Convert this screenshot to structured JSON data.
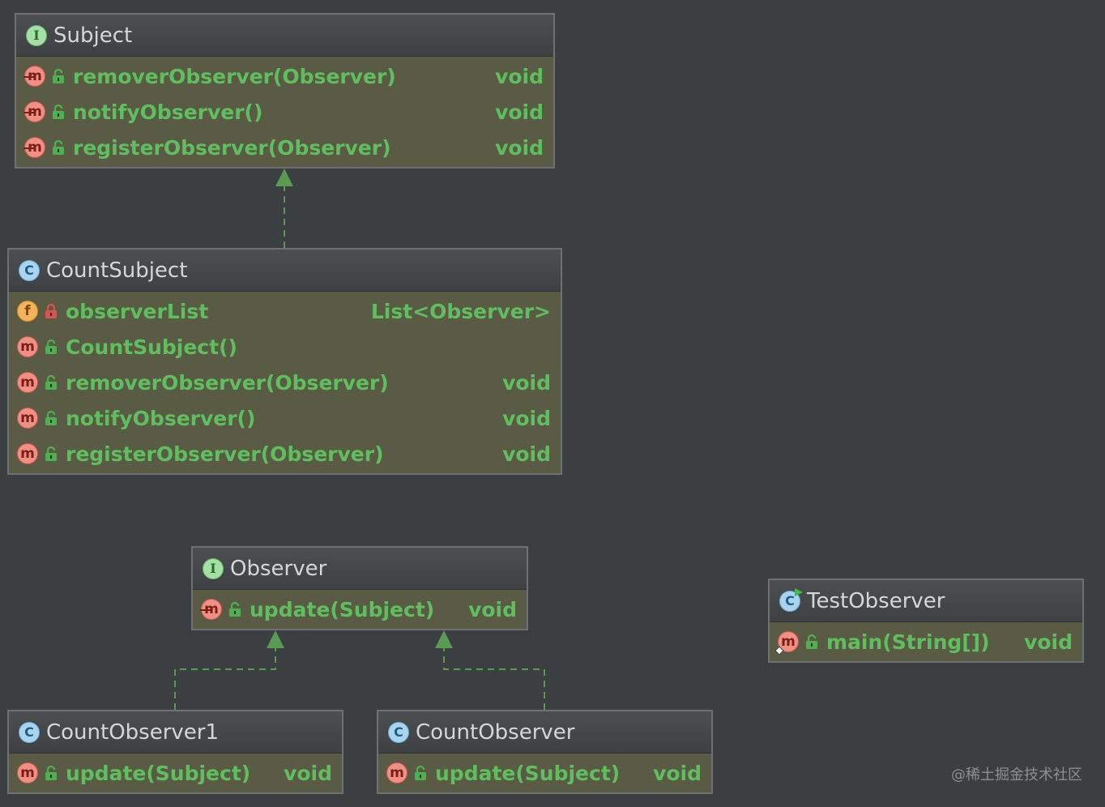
{
  "diagram": {
    "nodes": [
      {
        "id": "subject",
        "kind": "interface",
        "kind_letter": "I",
        "title": "Subject",
        "members": [
          {
            "icon": "method-abstract-icon",
            "letter": "m",
            "visibility": "public",
            "name": "removerObserver(Observer)",
            "type": "void"
          },
          {
            "icon": "method-abstract-icon",
            "letter": "m",
            "visibility": "public",
            "name": "notifyObserver()",
            "type": "void"
          },
          {
            "icon": "method-abstract-icon",
            "letter": "m",
            "visibility": "public",
            "name": "registerObserver(Observer)",
            "type": "void"
          }
        ]
      },
      {
        "id": "count-subject",
        "kind": "class",
        "kind_letter": "C",
        "title": "CountSubject",
        "members": [
          {
            "icon": "field-icon",
            "letter": "f",
            "visibility": "private",
            "name": "observerList",
            "type": "List<Observer>"
          },
          {
            "icon": "method-icon",
            "letter": "m",
            "visibility": "public",
            "name": "CountSubject()",
            "type": ""
          },
          {
            "icon": "method-icon",
            "letter": "m",
            "visibility": "public",
            "name": "removerObserver(Observer)",
            "type": "void"
          },
          {
            "icon": "method-icon",
            "letter": "m",
            "visibility": "public",
            "name": "notifyObserver()",
            "type": "void"
          },
          {
            "icon": "method-icon",
            "letter": "m",
            "visibility": "public",
            "name": "registerObserver(Observer)",
            "type": "void"
          }
        ]
      },
      {
        "id": "observer",
        "kind": "interface",
        "kind_letter": "I",
        "title": "Observer",
        "members": [
          {
            "icon": "method-abstract-icon",
            "letter": "m",
            "visibility": "public",
            "name": "update(Subject)",
            "type": "void"
          }
        ]
      },
      {
        "id": "test-observer",
        "kind": "class-main",
        "kind_letter": "C",
        "title": "TestObserver",
        "members": [
          {
            "icon": "method-static-icon",
            "letter": "m",
            "visibility": "public",
            "name": "main(String[])",
            "type": "void"
          }
        ]
      },
      {
        "id": "count-observer1",
        "kind": "class",
        "kind_letter": "C",
        "title": "CountObserver1",
        "members": [
          {
            "icon": "method-icon",
            "letter": "m",
            "visibility": "public",
            "name": "update(Subject)",
            "type": "void"
          }
        ]
      },
      {
        "id": "count-observer",
        "kind": "class",
        "kind_letter": "C",
        "title": "CountObserver",
        "members": [
          {
            "icon": "method-icon",
            "letter": "m",
            "visibility": "public",
            "name": "update(Subject)",
            "type": "void"
          }
        ]
      }
    ],
    "edges": [
      {
        "from": "count-subject",
        "to": "subject",
        "relation": "implements"
      },
      {
        "from": "count-observer1",
        "to": "observer",
        "relation": "implements"
      },
      {
        "from": "count-observer",
        "to": "observer",
        "relation": "implements"
      }
    ],
    "colors": {
      "background": "#3c3f41",
      "node_body": "#595b44",
      "member_text": "#5fbf5f",
      "title_text": "#d4d6d8",
      "edge": "#5a9a52"
    }
  },
  "watermark": "@稀土掘金技术社区"
}
